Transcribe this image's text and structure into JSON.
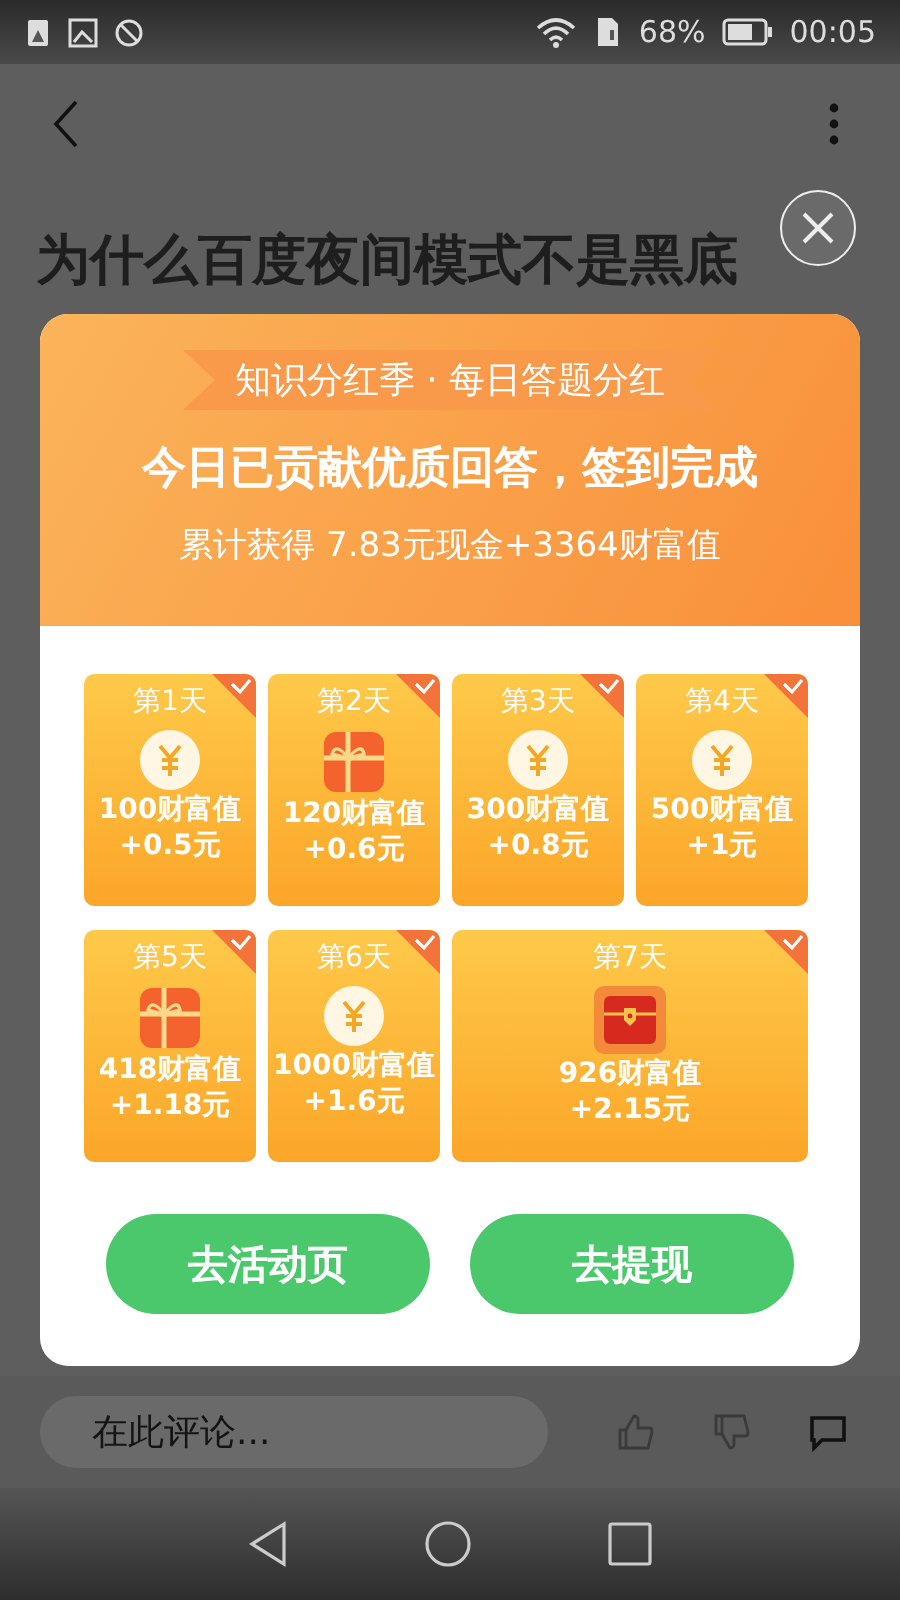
{
  "status_bar": {
    "battery": "68%",
    "time": "00:05"
  },
  "header": {
    "title": "为什么百度夜间模式不是黑底"
  },
  "dialog": {
    "banner": "知识分红季 · 每日答题分红",
    "headline": "今日已贡献优质回答，签到完成",
    "summary": "累计获得 7.83元现金+3364财富值",
    "days": [
      {
        "label": "第1天",
        "kind": "coin",
        "wealth": "100财富值",
        "cash": "+0.5元",
        "checked": true,
        "wide": false
      },
      {
        "label": "第2天",
        "kind": "gift",
        "wealth": "120财富值",
        "cash": "+0.6元",
        "checked": true,
        "wide": false
      },
      {
        "label": "第3天",
        "kind": "coin",
        "wealth": "300财富值",
        "cash": "+0.8元",
        "checked": true,
        "wide": false
      },
      {
        "label": "第4天",
        "kind": "coin",
        "wealth": "500财富值",
        "cash": "+1元",
        "checked": true,
        "wide": false
      },
      {
        "label": "第5天",
        "kind": "gift",
        "wealth": "418财富值",
        "cash": "+1.18元",
        "checked": true,
        "wide": false
      },
      {
        "label": "第6天",
        "kind": "coin",
        "wealth": "1000财富值",
        "cash": "+1.6元",
        "checked": true,
        "wide": false
      },
      {
        "label": "第7天",
        "kind": "chest",
        "wealth": "926财富值",
        "cash": "+2.15元",
        "checked": true,
        "wide": true
      }
    ],
    "buttons": [
      "去活动页",
      "去提现"
    ]
  },
  "comment_bar": {
    "placeholder": "在此评论..."
  }
}
